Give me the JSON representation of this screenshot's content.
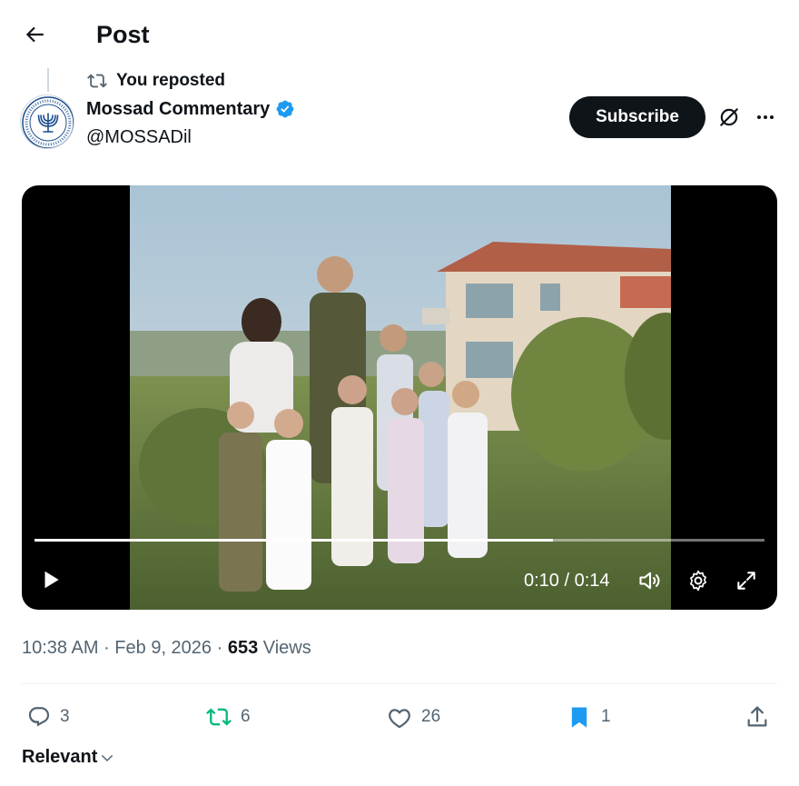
{
  "header": {
    "title": "Post",
    "back_icon": "arrow-left-icon"
  },
  "repost": {
    "label": "You reposted",
    "icon": "repost-icon"
  },
  "author": {
    "name": "Mossad Commentary",
    "handle": "@MOSSADil",
    "verified": true,
    "verified_color": "#1d9bf0"
  },
  "actions_top": {
    "subscribe_label": "Subscribe",
    "grok_icon": "grok-icon",
    "more_icon": "more-icon"
  },
  "video": {
    "current_time": "0:10",
    "separator": " / ",
    "duration": "0:14",
    "progress_fraction": 0.71
  },
  "meta": {
    "time": "10:38 AM",
    "dot": " · ",
    "date": "Feb 9, 2026",
    "views_count": "653",
    "views_label": " Views"
  },
  "engagement": {
    "replies": "3",
    "reposts": "6",
    "likes": "26",
    "bookmarks": "1",
    "repost_color": "#00ba7c",
    "bookmark_color": "#1d9bf0"
  },
  "sort": {
    "label": "Relevant"
  }
}
